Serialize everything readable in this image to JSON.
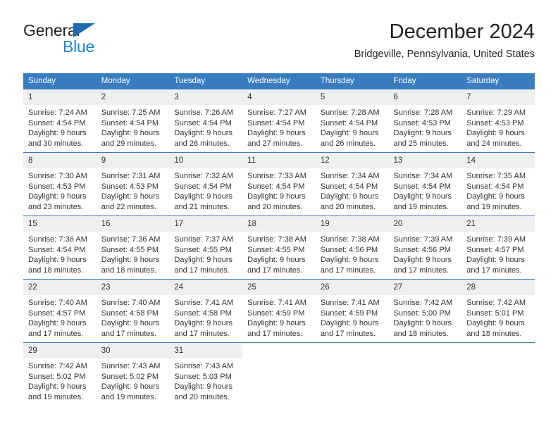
{
  "brand": {
    "name_part1": "General",
    "name_part2": "Blue",
    "accent_color": "#1f86d8",
    "triangle_color": "#1b6cb3"
  },
  "header": {
    "title": "December 2024",
    "subtitle": "Bridgeville, Pennsylvania, United States",
    "header_bg_color": "#3a7cc0"
  },
  "weekday_headers": [
    "Sunday",
    "Monday",
    "Tuesday",
    "Wednesday",
    "Thursday",
    "Friday",
    "Saturday"
  ],
  "weeks": [
    [
      {
        "day": "1",
        "sunrise": "Sunrise: 7:24 AM",
        "sunset": "Sunset: 4:54 PM",
        "daylight_line1": "Daylight: 9 hours",
        "daylight_line2": "and 30 minutes."
      },
      {
        "day": "2",
        "sunrise": "Sunrise: 7:25 AM",
        "sunset": "Sunset: 4:54 PM",
        "daylight_line1": "Daylight: 9 hours",
        "daylight_line2": "and 29 minutes."
      },
      {
        "day": "3",
        "sunrise": "Sunrise: 7:26 AM",
        "sunset": "Sunset: 4:54 PM",
        "daylight_line1": "Daylight: 9 hours",
        "daylight_line2": "and 28 minutes."
      },
      {
        "day": "4",
        "sunrise": "Sunrise: 7:27 AM",
        "sunset": "Sunset: 4:54 PM",
        "daylight_line1": "Daylight: 9 hours",
        "daylight_line2": "and 27 minutes."
      },
      {
        "day": "5",
        "sunrise": "Sunrise: 7:28 AM",
        "sunset": "Sunset: 4:54 PM",
        "daylight_line1": "Daylight: 9 hours",
        "daylight_line2": "and 26 minutes."
      },
      {
        "day": "6",
        "sunrise": "Sunrise: 7:28 AM",
        "sunset": "Sunset: 4:53 PM",
        "daylight_line1": "Daylight: 9 hours",
        "daylight_line2": "and 25 minutes."
      },
      {
        "day": "7",
        "sunrise": "Sunrise: 7:29 AM",
        "sunset": "Sunset: 4:53 PM",
        "daylight_line1": "Daylight: 9 hours",
        "daylight_line2": "and 24 minutes."
      }
    ],
    [
      {
        "day": "8",
        "sunrise": "Sunrise: 7:30 AM",
        "sunset": "Sunset: 4:53 PM",
        "daylight_line1": "Daylight: 9 hours",
        "daylight_line2": "and 23 minutes."
      },
      {
        "day": "9",
        "sunrise": "Sunrise: 7:31 AM",
        "sunset": "Sunset: 4:53 PM",
        "daylight_line1": "Daylight: 9 hours",
        "daylight_line2": "and 22 minutes."
      },
      {
        "day": "10",
        "sunrise": "Sunrise: 7:32 AM",
        "sunset": "Sunset: 4:54 PM",
        "daylight_line1": "Daylight: 9 hours",
        "daylight_line2": "and 21 minutes."
      },
      {
        "day": "11",
        "sunrise": "Sunrise: 7:33 AM",
        "sunset": "Sunset: 4:54 PM",
        "daylight_line1": "Daylight: 9 hours",
        "daylight_line2": "and 20 minutes."
      },
      {
        "day": "12",
        "sunrise": "Sunrise: 7:34 AM",
        "sunset": "Sunset: 4:54 PM",
        "daylight_line1": "Daylight: 9 hours",
        "daylight_line2": "and 20 minutes."
      },
      {
        "day": "13",
        "sunrise": "Sunrise: 7:34 AM",
        "sunset": "Sunset: 4:54 PM",
        "daylight_line1": "Daylight: 9 hours",
        "daylight_line2": "and 19 minutes."
      },
      {
        "day": "14",
        "sunrise": "Sunrise: 7:35 AM",
        "sunset": "Sunset: 4:54 PM",
        "daylight_line1": "Daylight: 9 hours",
        "daylight_line2": "and 19 minutes."
      }
    ],
    [
      {
        "day": "15",
        "sunrise": "Sunrise: 7:36 AM",
        "sunset": "Sunset: 4:54 PM",
        "daylight_line1": "Daylight: 9 hours",
        "daylight_line2": "and 18 minutes."
      },
      {
        "day": "16",
        "sunrise": "Sunrise: 7:36 AM",
        "sunset": "Sunset: 4:55 PM",
        "daylight_line1": "Daylight: 9 hours",
        "daylight_line2": "and 18 minutes."
      },
      {
        "day": "17",
        "sunrise": "Sunrise: 7:37 AM",
        "sunset": "Sunset: 4:55 PM",
        "daylight_line1": "Daylight: 9 hours",
        "daylight_line2": "and 17 minutes."
      },
      {
        "day": "18",
        "sunrise": "Sunrise: 7:38 AM",
        "sunset": "Sunset: 4:55 PM",
        "daylight_line1": "Daylight: 9 hours",
        "daylight_line2": "and 17 minutes."
      },
      {
        "day": "19",
        "sunrise": "Sunrise: 7:38 AM",
        "sunset": "Sunset: 4:56 PM",
        "daylight_line1": "Daylight: 9 hours",
        "daylight_line2": "and 17 minutes."
      },
      {
        "day": "20",
        "sunrise": "Sunrise: 7:39 AM",
        "sunset": "Sunset: 4:56 PM",
        "daylight_line1": "Daylight: 9 hours",
        "daylight_line2": "and 17 minutes."
      },
      {
        "day": "21",
        "sunrise": "Sunrise: 7:39 AM",
        "sunset": "Sunset: 4:57 PM",
        "daylight_line1": "Daylight: 9 hours",
        "daylight_line2": "and 17 minutes."
      }
    ],
    [
      {
        "day": "22",
        "sunrise": "Sunrise: 7:40 AM",
        "sunset": "Sunset: 4:57 PM",
        "daylight_line1": "Daylight: 9 hours",
        "daylight_line2": "and 17 minutes."
      },
      {
        "day": "23",
        "sunrise": "Sunrise: 7:40 AM",
        "sunset": "Sunset: 4:58 PM",
        "daylight_line1": "Daylight: 9 hours",
        "daylight_line2": "and 17 minutes."
      },
      {
        "day": "24",
        "sunrise": "Sunrise: 7:41 AM",
        "sunset": "Sunset: 4:58 PM",
        "daylight_line1": "Daylight: 9 hours",
        "daylight_line2": "and 17 minutes."
      },
      {
        "day": "25",
        "sunrise": "Sunrise: 7:41 AM",
        "sunset": "Sunset: 4:59 PM",
        "daylight_line1": "Daylight: 9 hours",
        "daylight_line2": "and 17 minutes."
      },
      {
        "day": "26",
        "sunrise": "Sunrise: 7:41 AM",
        "sunset": "Sunset: 4:59 PM",
        "daylight_line1": "Daylight: 9 hours",
        "daylight_line2": "and 17 minutes."
      },
      {
        "day": "27",
        "sunrise": "Sunrise: 7:42 AM",
        "sunset": "Sunset: 5:00 PM",
        "daylight_line1": "Daylight: 9 hours",
        "daylight_line2": "and 18 minutes."
      },
      {
        "day": "28",
        "sunrise": "Sunrise: 7:42 AM",
        "sunset": "Sunset: 5:01 PM",
        "daylight_line1": "Daylight: 9 hours",
        "daylight_line2": "and 18 minutes."
      }
    ],
    [
      {
        "day": "29",
        "sunrise": "Sunrise: 7:42 AM",
        "sunset": "Sunset: 5:02 PM",
        "daylight_line1": "Daylight: 9 hours",
        "daylight_line2": "and 19 minutes."
      },
      {
        "day": "30",
        "sunrise": "Sunrise: 7:43 AM",
        "sunset": "Sunset: 5:02 PM",
        "daylight_line1": "Daylight: 9 hours",
        "daylight_line2": "and 19 minutes."
      },
      {
        "day": "31",
        "sunrise": "Sunrise: 7:43 AM",
        "sunset": "Sunset: 5:03 PM",
        "daylight_line1": "Daylight: 9 hours",
        "daylight_line2": "and 20 minutes."
      },
      {
        "day": "",
        "sunrise": "",
        "sunset": "",
        "daylight_line1": "",
        "daylight_line2": ""
      },
      {
        "day": "",
        "sunrise": "",
        "sunset": "",
        "daylight_line1": "",
        "daylight_line2": ""
      },
      {
        "day": "",
        "sunrise": "",
        "sunset": "",
        "daylight_line1": "",
        "daylight_line2": ""
      },
      {
        "day": "",
        "sunrise": "",
        "sunset": "",
        "daylight_line1": "",
        "daylight_line2": ""
      }
    ]
  ]
}
